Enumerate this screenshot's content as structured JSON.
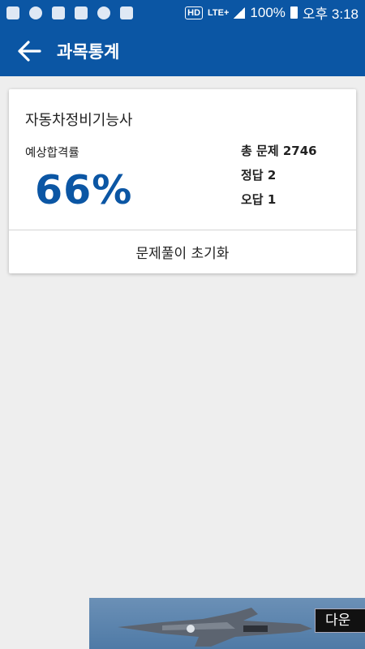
{
  "status_bar": {
    "battery_percent": "100%",
    "time": "오후 3:18",
    "hd_label": "HD",
    "network_label": "LTE+"
  },
  "app_bar": {
    "title": "과목통계"
  },
  "card": {
    "subject": "자동차정비기능사",
    "pass_label": "예상합격률",
    "pass_value": "66%",
    "total_questions": "총 문제 2746",
    "correct": "정답 2",
    "wrong": "오답 1",
    "reset_label": "문제풀이 초기화"
  },
  "ad": {
    "button_label": "다운"
  },
  "colors": {
    "primary": "#0b56a4",
    "background": "#eeeeee"
  }
}
